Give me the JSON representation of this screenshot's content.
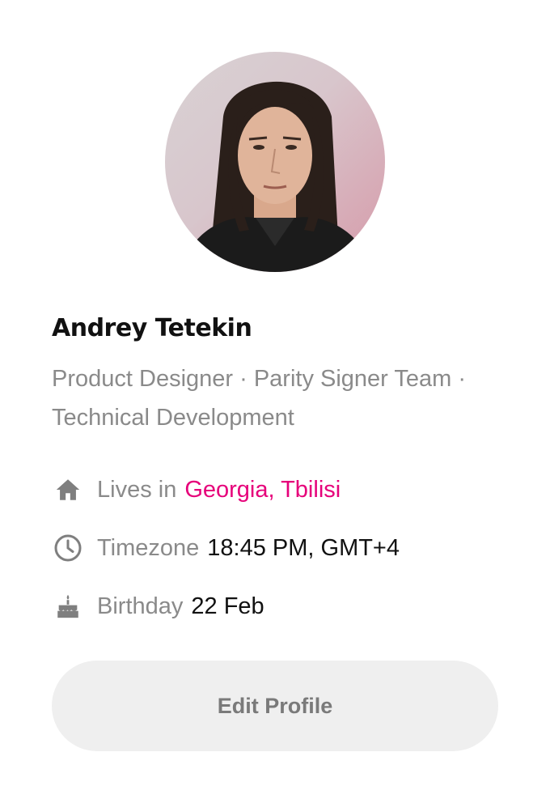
{
  "profile": {
    "name": "Andrey Tetekin",
    "role": "Product Designer · Parity Signer Team · Technical Development",
    "avatar_icon": "avatar-photo"
  },
  "details": {
    "lives": {
      "label": "Lives in",
      "value": "Georgia, Tbilisi",
      "icon": "home-icon"
    },
    "timezone": {
      "label": "Timezone",
      "value": "18:45 PM, GMT+4",
      "icon": "clock-icon"
    },
    "birthday": {
      "label": "Birthday",
      "value": "22 Feb",
      "icon": "cake-icon"
    }
  },
  "actions": {
    "edit_label": "Edit Profile"
  },
  "colors": {
    "accent": "#e6007a",
    "muted_text": "#8a8a8a",
    "primary_text": "#111111",
    "button_bg": "#efefef"
  }
}
